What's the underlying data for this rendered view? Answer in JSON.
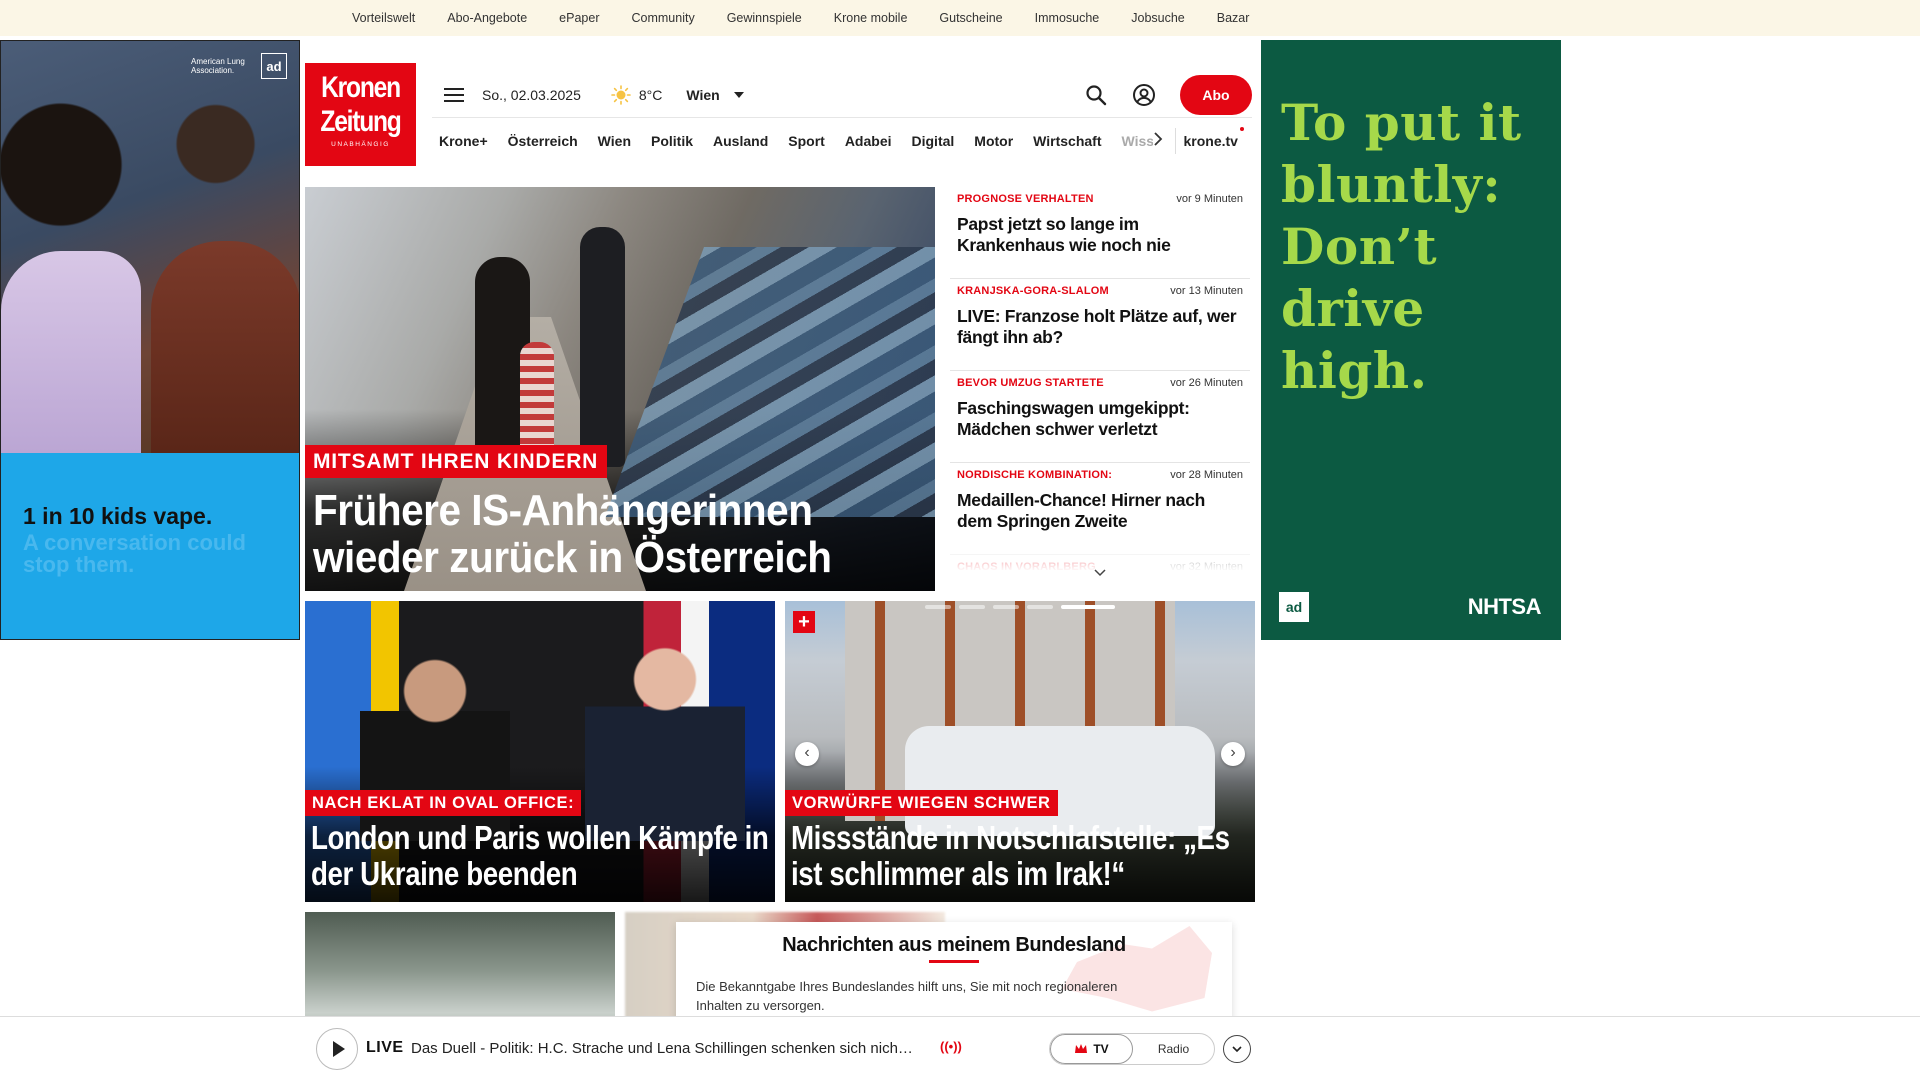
{
  "topbar": {
    "links": [
      "Vorteilswelt",
      "Abo-Angebote",
      "ePaper",
      "Community",
      "Gewinnspiele",
      "Krone mobile",
      "Gutscheine",
      "Immosuche",
      "Jobsuche",
      "Bazar"
    ]
  },
  "ad_left": {
    "logo_text": "American Lung Association.",
    "badge": "ad",
    "headline": "1 in 10 kids vape.",
    "subline": "A conversation could stop them."
  },
  "ad_right": {
    "headline": "To put it bluntly: Don’t drive high.",
    "badge": "ad",
    "sponsor": "NHTSA"
  },
  "header": {
    "logo_line1": "Kronen",
    "logo_line2": "Zeitung",
    "logo_sub": "UNABHÄNGIG",
    "date": "So., 02.03.2025",
    "temperature": "8°C",
    "city": "Wien",
    "abo_label": "Abo",
    "icons": [
      "menu-icon",
      "sun-icon",
      "search-icon",
      "user-icon"
    ]
  },
  "nav": {
    "items": [
      "Krone+",
      "Österreich",
      "Wien",
      "Politik",
      "Ausland",
      "Sport",
      "Adabei",
      "Digital",
      "Motor",
      "Wirtschaft"
    ],
    "faded_item": "Wiss",
    "tv_label": "krone.tv"
  },
  "hero": {
    "kicker": "MITSAMT IHREN KINDERN",
    "title": "Frühere IS-Anhängerinnen wieder zurück in Österreich"
  },
  "news_list": [
    {
      "kicker": "PROGNOSE VERHALTEN",
      "time": "vor 9 Minuten",
      "title": "Papst jetzt so lange im Krankenhaus wie noch nie"
    },
    {
      "kicker": "KRANJSKA-GORA-SLALOM",
      "time": "vor 13 Minuten",
      "title": "LIVE: Franzose holt Plätze auf, wer fängt ihn ab?"
    },
    {
      "kicker": "BEVOR UMZUG STARTETE",
      "time": "vor 26 Minuten",
      "title": "Faschingswagen umgekippt: Mädchen schwer verletzt"
    },
    {
      "kicker": "NORDISCHE KOMBINATION:",
      "time": "vor 28 Minuten",
      "title": "Medaillen-Chance! Hirner nach dem Springen Zweite"
    },
    {
      "kicker": "CHAOS IN VORARLBERG",
      "time": "vor 32 Minuten",
      "title": ""
    }
  ],
  "stories": [
    {
      "kicker": "NACH EKLAT IN OVAL OFFICE:",
      "title": "London und Paris wollen Kämpfe in der Ukraine beenden"
    },
    {
      "kicker": "VORWÜRFE WIEGEN SCHWER",
      "title": "Missstände in Notschlafstelle: „Es ist schlimmer als im Irak!“",
      "plus": "+"
    }
  ],
  "region_prompt": {
    "title": "Nachrichten aus meinem Bundesland",
    "text": "Die Bekanntgabe Ihres Bundeslandes hilft uns, Sie mit noch regionaleren Inhalten zu versorgen."
  },
  "live_bar": {
    "label": "LIVE",
    "title": "Das Duell - Politik: H.C. Strache und Lena Schillingen schenken sich nich…",
    "signal": "((•))",
    "toggle": [
      "TV",
      "Radio"
    ],
    "active_toggle": "TV"
  },
  "colors": {
    "brand_red": "#e30613",
    "topbar_bg": "#fbf6e6",
    "ad_green": "#0c5a42",
    "ad_lime": "#a6d94a",
    "ad_blue": "#1ea7e8"
  }
}
